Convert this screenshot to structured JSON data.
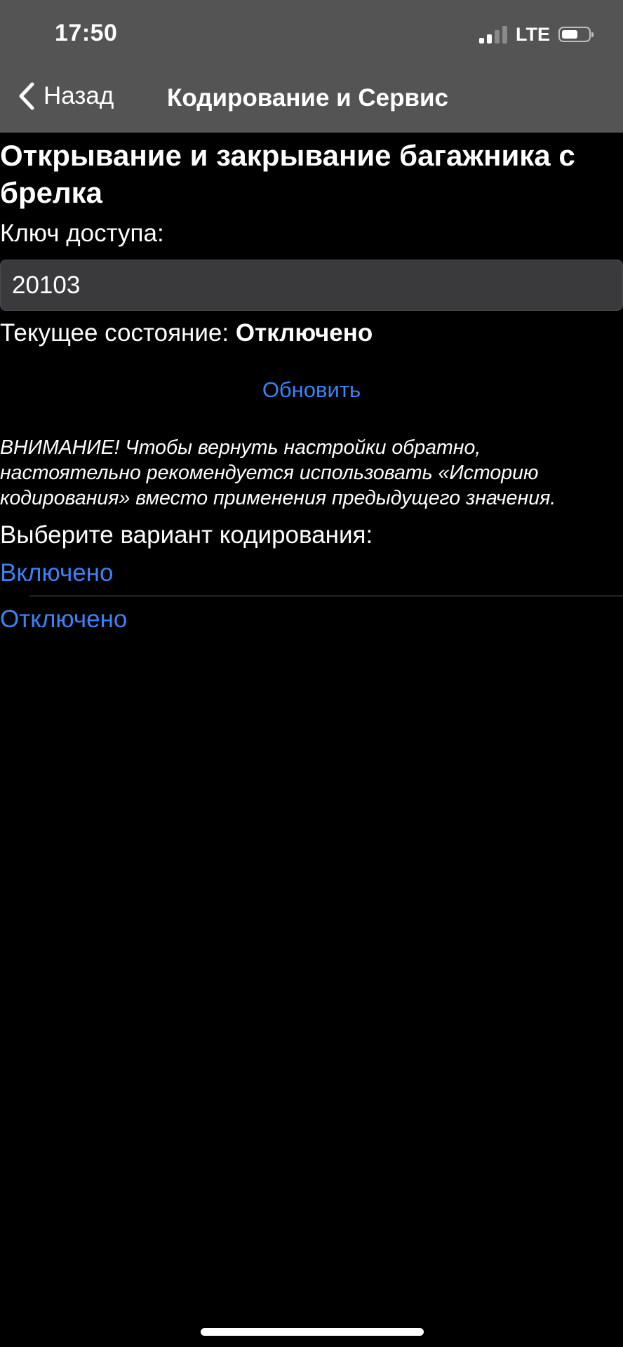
{
  "status_bar": {
    "time": "17:50",
    "network": "LTE",
    "signal_icon": "signal-bars-icon",
    "battery_icon": "battery-icon"
  },
  "nav": {
    "back_label": "Назад",
    "title": "Кодирование и Сервис",
    "back_icon": "chevron-left-icon"
  },
  "page": {
    "heading": "Открывание и закрывание багажника с брелка",
    "access_key_label": "Ключ доступа:",
    "access_key_value": "20103",
    "current_state_label": "Текущее состояние:",
    "current_state_value": "Отключено",
    "update_button": "Обновить",
    "warning": "ВНИМАНИЕ! Чтобы вернуть настройки обратно, настоятельно рекомендуется использовать «Историю кодирования» вместо применения предыдущего значения.",
    "choose_label": "Выберите вариант кодирования:",
    "options": [
      "Включено",
      "Отключено"
    ]
  },
  "colors": {
    "accent": "#3b82f6",
    "background": "#000000",
    "nav_background": "#545454",
    "field_background": "#3a3a3c"
  }
}
